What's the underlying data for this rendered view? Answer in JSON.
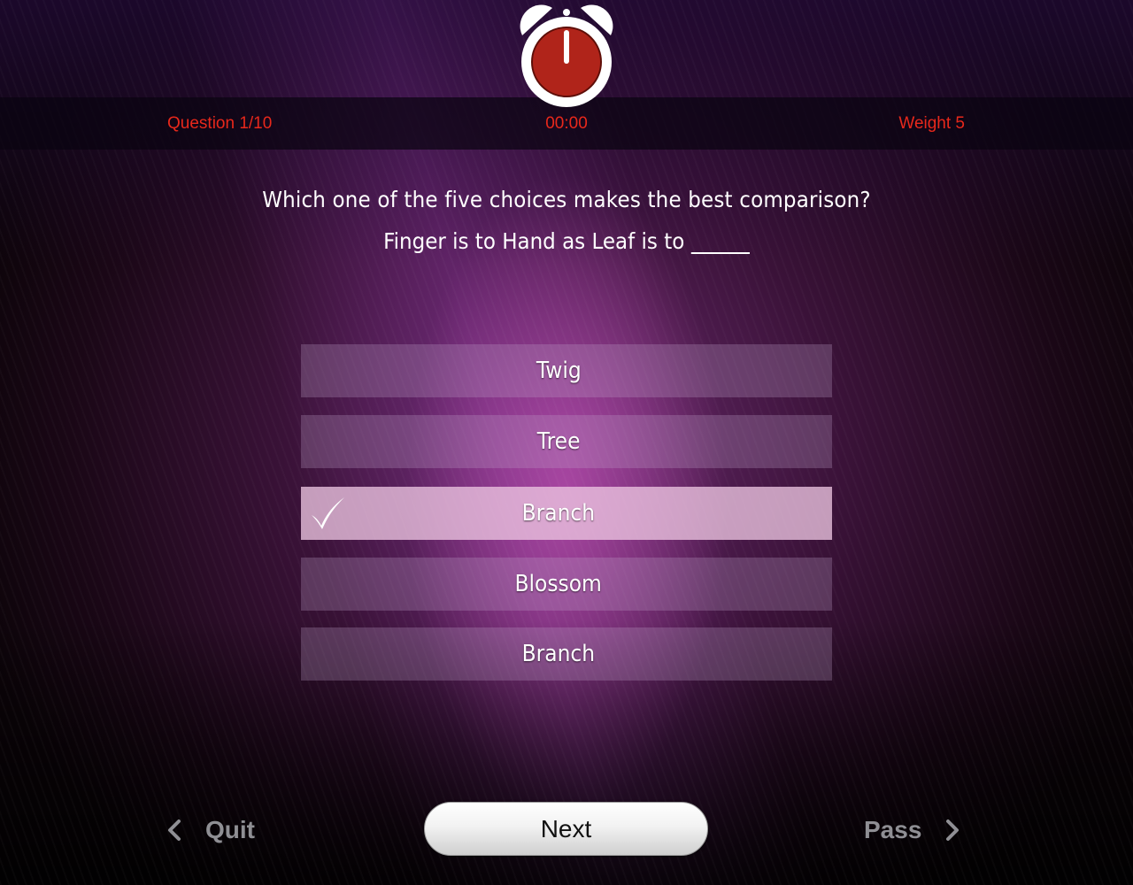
{
  "header": {
    "question_counter": "Question 1/10",
    "timer": "00:00",
    "weight": "Weight 5"
  },
  "question": {
    "text": "Which one of the five choices makes the best comparison?",
    "prompt": "Finger is to Hand as Leaf is to"
  },
  "choices": [
    {
      "label": "Twig",
      "selected": false
    },
    {
      "label": "Tree",
      "selected": false
    },
    {
      "label": "Branch",
      "selected": true
    },
    {
      "label": "Blossom",
      "selected": false
    },
    {
      "label": "Branch",
      "selected": false
    }
  ],
  "footer": {
    "quit_label": "Quit",
    "next_label": "Next",
    "pass_label": "Pass"
  },
  "colors": {
    "accent_red": "#e8281b",
    "clock_face": "#b0241a"
  },
  "icons": {
    "clock": "alarm-clock-icon",
    "check": "checkmark-icon",
    "left": "chevron-left-icon",
    "right": "chevron-right-icon"
  }
}
